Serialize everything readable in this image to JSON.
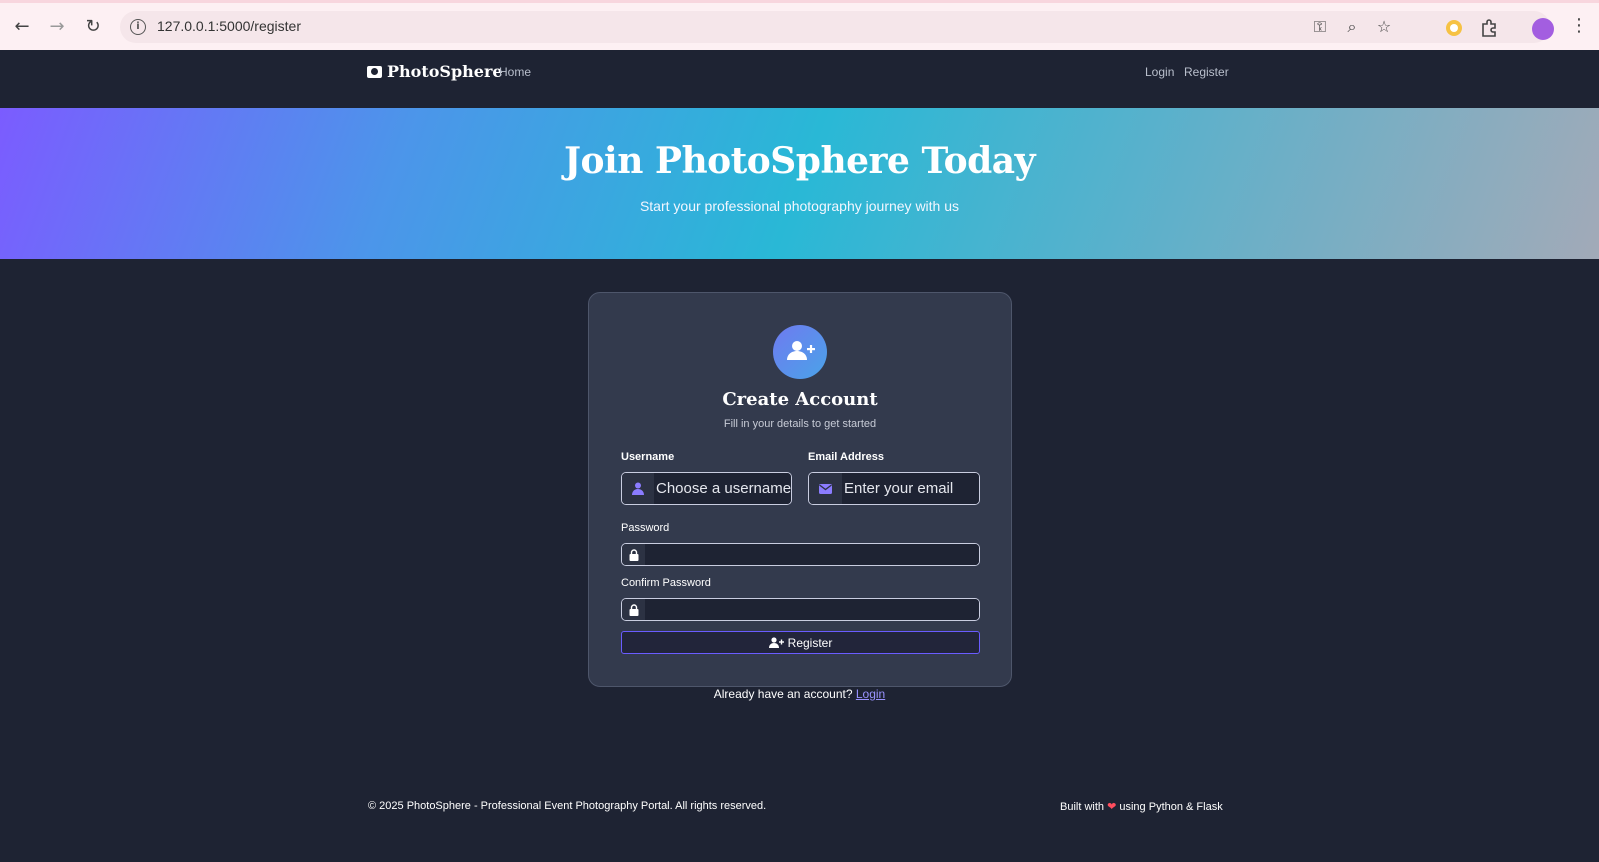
{
  "browser": {
    "url": "127.0.0.1:5000/register",
    "back_icon": "arrow-left-icon",
    "forward_icon": "arrow-right-icon",
    "reload_icon": "reload-icon"
  },
  "navbar": {
    "brand": "PhotoSphere",
    "home": "Home",
    "login": "Login",
    "register": "Register"
  },
  "hero": {
    "title": "Join PhotoSphere Today",
    "subtitle": "Start your professional photography journey with us"
  },
  "card": {
    "title": "Create Account",
    "subtitle": "Fill in your details to get started",
    "username_label": "Username",
    "username_placeholder": "Choose a username",
    "email_label": "Email Address",
    "email_placeholder": "Enter your email",
    "password_label": "Password",
    "confirm_label": "Confirm Password",
    "register_label": "Register"
  },
  "login_prompt": {
    "text": "Already have an account?",
    "link": "Login"
  },
  "footer": {
    "copyright": "© 2025 PhotoSphere - Professional Event Photography Portal. All rights reserved.",
    "built_prefix": "Built with",
    "built_suffix": "using Python & Flask"
  },
  "colors": {
    "page_bg": "#1e2333",
    "card_bg": "#333a4d",
    "accent": "#6a5cff",
    "link": "#9a93ff",
    "heart": "#ff4d5e"
  }
}
